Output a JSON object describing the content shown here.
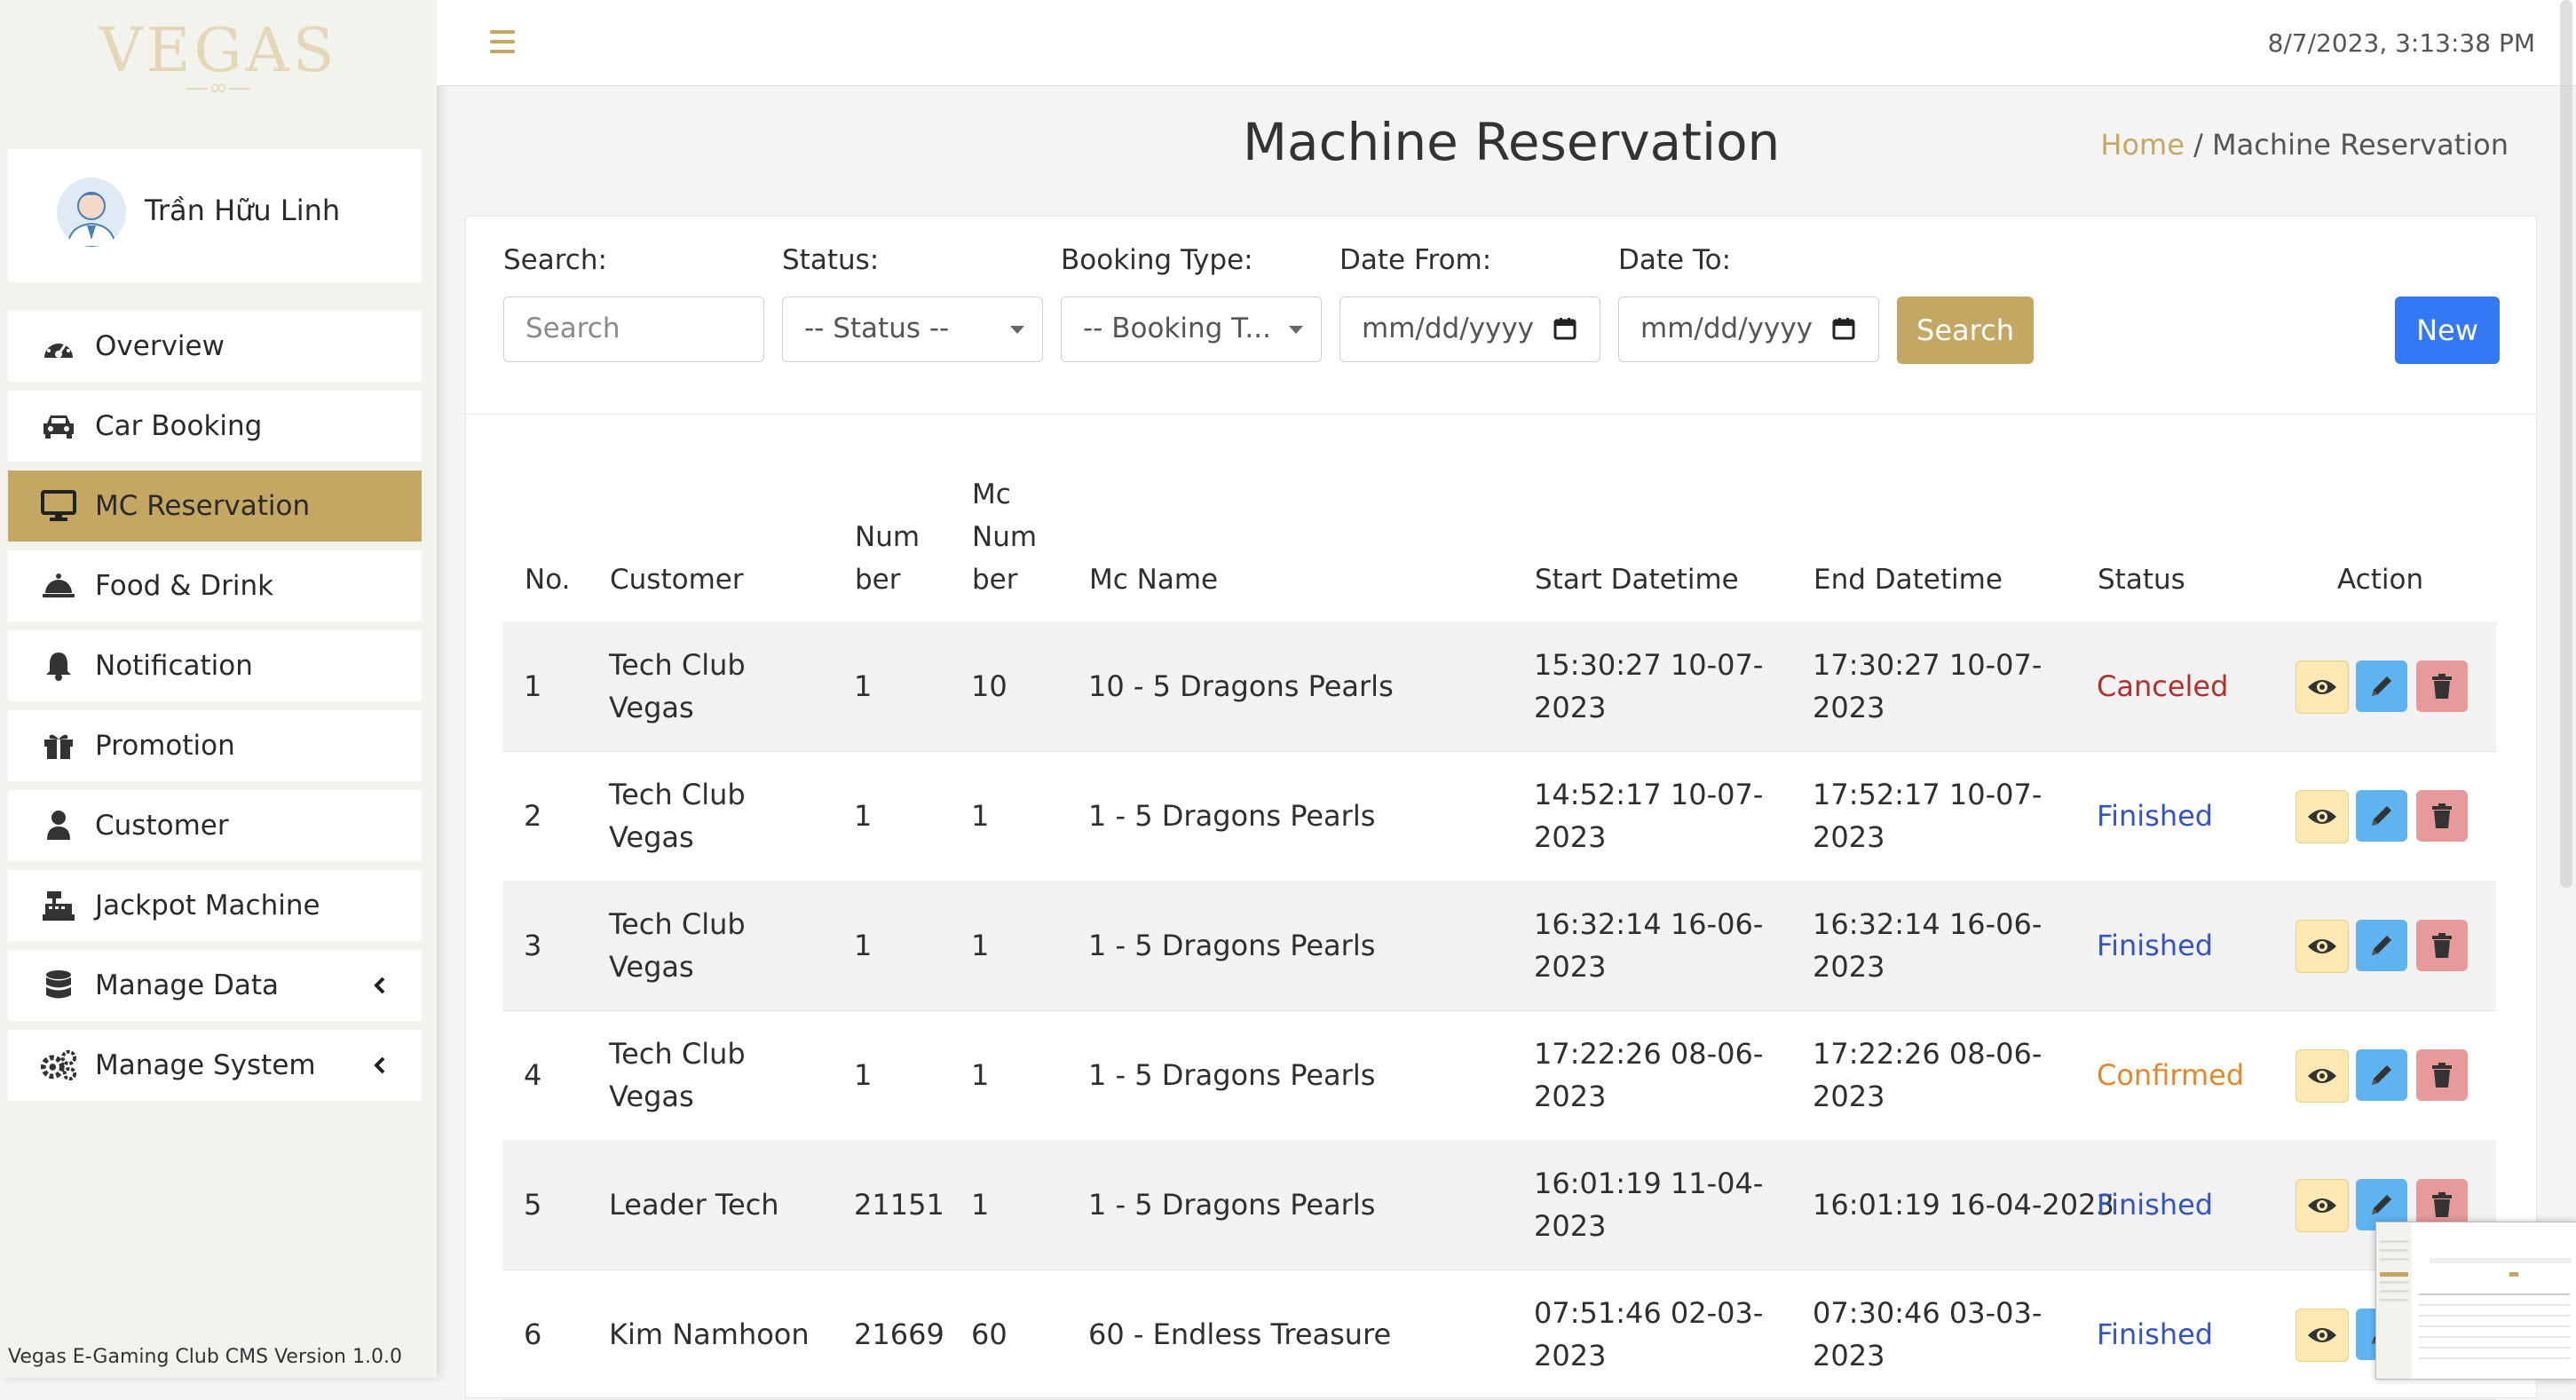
{
  "app": {
    "logo": "VEGAS",
    "logo_sub": "—∞—",
    "version": "Vegas E-Gaming Club CMS Version 1.0.0"
  },
  "user": {
    "name": "Trần Hữu Linh"
  },
  "sidebar": {
    "items": [
      {
        "label": "Overview",
        "icon": "gauge-icon"
      },
      {
        "label": "Car Booking",
        "icon": "car-icon"
      },
      {
        "label": "MC Reservation",
        "icon": "monitor-icon",
        "active": true
      },
      {
        "label": "Food & Drink",
        "icon": "cloche-icon"
      },
      {
        "label": "Notification",
        "icon": "bell-icon"
      },
      {
        "label": "Promotion",
        "icon": "gift-icon"
      },
      {
        "label": "Customer",
        "icon": "user-icon"
      },
      {
        "label": "Jackpot Machine",
        "icon": "cash-register-icon"
      },
      {
        "label": "Manage Data",
        "icon": "database-icon",
        "expandable": true
      },
      {
        "label": "Manage System",
        "icon": "cogs-icon",
        "expandable": true
      }
    ]
  },
  "topbar": {
    "datetime": "8/7/2023, 3:13:38 PM"
  },
  "page": {
    "title": "Machine Reservation",
    "breadcrumb": {
      "home": "Home",
      "separator": "/",
      "current": "Machine Reservation"
    }
  },
  "filters": {
    "search_label": "Search:",
    "search_placeholder": "Search",
    "status_label": "Status:",
    "status_value": "-- Status --",
    "booking_label": "Booking Type:",
    "booking_value": "-- Booking T...",
    "date_from_label": "Date From:",
    "date_from_value": "mm/dd/yyyy",
    "date_to_label": "Date To:",
    "date_to_value": "mm/dd/yyyy",
    "search_button": "Search",
    "new_button": "New"
  },
  "table": {
    "headers": {
      "no": "No.",
      "customer": "Customer",
      "number_1": "Num",
      "number_2": "ber",
      "mc_1": "Mc",
      "mc_2": "Num",
      "mc_3": "ber",
      "mc_name": "Mc Name",
      "start": "Start Datetime",
      "end": "End Datetime",
      "status": "Status",
      "action": "Action"
    },
    "rows": [
      {
        "no": "1",
        "customer_1": "Tech Club",
        "customer_2": "Vegas",
        "number": "1",
        "mc_number": "10",
        "mc_name": "10 - 5 Dragons Pearls",
        "start_1": "15:30:27 10-07-",
        "start_2": "2023",
        "end_1": "17:30:27 10-07-",
        "end_2": "2023",
        "status": "Canceled",
        "status_color": "#b0302f"
      },
      {
        "no": "2",
        "customer_1": "Tech Club",
        "customer_2": "Vegas",
        "number": "1",
        "mc_number": "1",
        "mc_name": "1 - 5 Dragons Pearls",
        "start_1": "14:52:17 10-07-",
        "start_2": "2023",
        "end_1": "17:52:17 10-07-",
        "end_2": "2023",
        "status": "Finished",
        "status_color": "#3553c4"
      },
      {
        "no": "3",
        "customer_1": "Tech Club",
        "customer_2": "Vegas",
        "number": "1",
        "mc_number": "1",
        "mc_name": "1 - 5 Dragons Pearls",
        "start_1": "16:32:14 16-06-",
        "start_2": "2023",
        "end_1": "16:32:14 16-06-",
        "end_2": "2023",
        "status": "Finished",
        "status_color": "#3553c4"
      },
      {
        "no": "4",
        "customer_1": "Tech Club",
        "customer_2": "Vegas",
        "number": "1",
        "mc_number": "1",
        "mc_name": "1 - 5 Dragons Pearls",
        "start_1": "17:22:26 08-06-",
        "start_2": "2023",
        "end_1": "17:22:26 08-06-",
        "end_2": "2023",
        "status": "Confirmed",
        "status_color": "#e0892a"
      },
      {
        "no": "5",
        "customer_1": "Leader Tech",
        "customer_2": "",
        "number": "21151",
        "mc_number": "1",
        "mc_name": "1 - 5 Dragons Pearls",
        "start_1": "16:01:19 11-04-",
        "start_2": "2023",
        "end_1": "16:01:19 16-04-2023",
        "end_2": "",
        "status": "Finished",
        "status_color": "#3553c4"
      },
      {
        "no": "6",
        "customer_1": "Kim Namhoon",
        "customer_2": "",
        "number": "21669",
        "mc_number": "60",
        "mc_name": "60 - Endless Treasure",
        "start_1": "07:51:46 02-03-",
        "start_2": "2023",
        "end_1": "07:30:46 03-03-",
        "end_2": "2023",
        "status": "Finished",
        "status_color": "#3553c4"
      }
    ]
  },
  "colors": {
    "accent": "#c5a764",
    "primary": "#3578f6",
    "view": "#fbe8b3",
    "edit": "#5fb4ef",
    "delete": "#e79a9a"
  }
}
